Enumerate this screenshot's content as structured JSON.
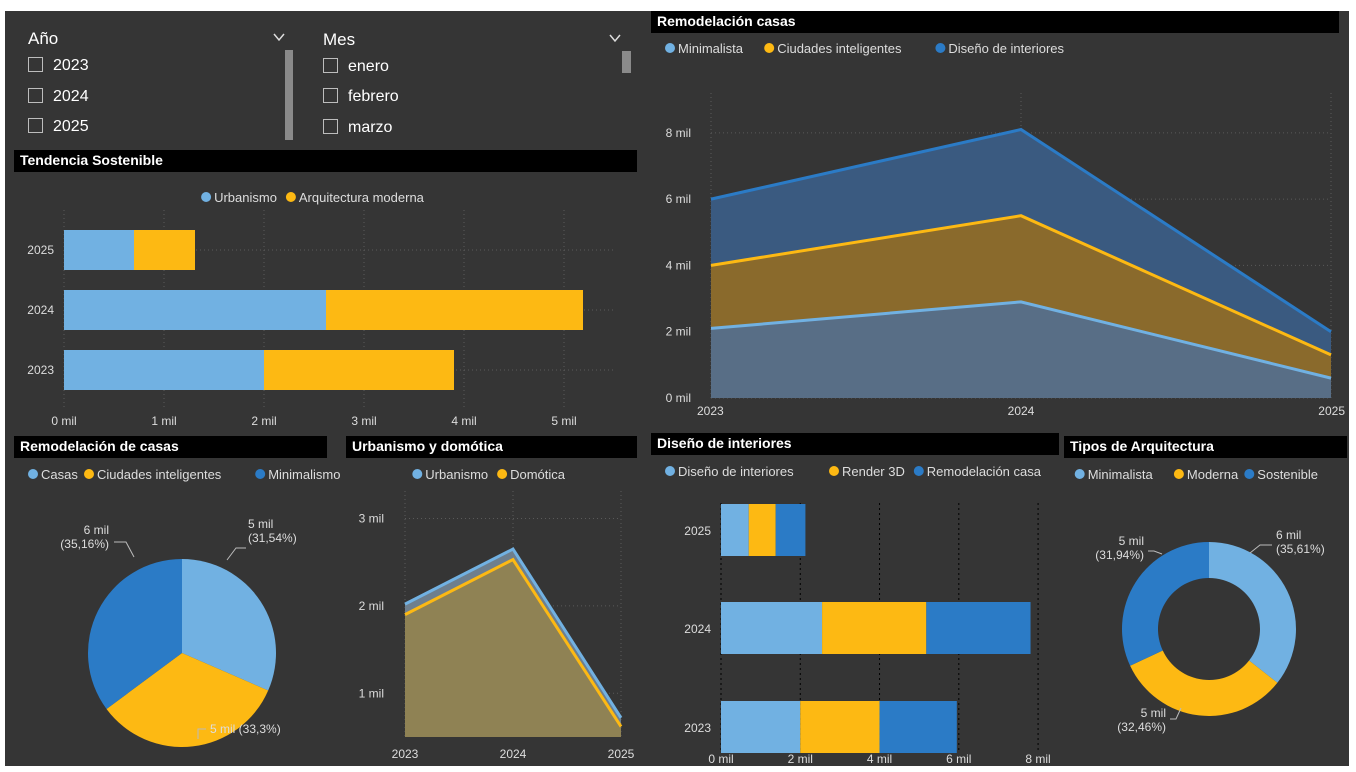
{
  "slicers": {
    "year": {
      "title": "Año",
      "options": [
        "2023",
        "2024",
        "2025"
      ]
    },
    "month": {
      "title": "Mes",
      "options": [
        "enero",
        "febrero",
        "marzo"
      ]
    }
  },
  "chart_data": [
    {
      "id": "tendencia",
      "type": "bar",
      "orientation": "horizontal",
      "stacked": true,
      "title": "Tendencia Sostenible",
      "categories": [
        "2025",
        "2024",
        "2023"
      ],
      "series": [
        {
          "name": "Urbanismo",
          "color": "#71B1E2",
          "values": [
            700,
            2620,
            2000
          ]
        },
        {
          "name": "Arquitectura moderna",
          "color": "#FDB913",
          "values": [
            610,
            2570,
            1900
          ]
        }
      ],
      "xlim": [
        0,
        5500
      ],
      "xticks": [
        0,
        1000,
        2000,
        3000,
        4000,
        5000
      ],
      "xtick_labels": [
        "0 mil",
        "1 mil",
        "2 mil",
        "3 mil",
        "4 mil",
        "5 mil"
      ],
      "legend": "top-center"
    },
    {
      "id": "remodelacion_area",
      "type": "area",
      "title": "Remodelación casas",
      "x": [
        "2023",
        "2024",
        "2025"
      ],
      "series": [
        {
          "name": "Minimalista",
          "color": "#71B1E2",
          "values": [
            2100,
            2900,
            600
          ]
        },
        {
          "name": "Ciudades inteligentes",
          "color": "#FDB913",
          "values": [
            4000,
            5500,
            1300
          ]
        },
        {
          "name": "Diseño de interiores",
          "color": "#2B7BC6",
          "values": [
            6000,
            8100,
            2000
          ]
        }
      ],
      "ylim": [
        0,
        8900
      ],
      "yticks": [
        0,
        2000,
        4000,
        6000,
        8000
      ],
      "ytick_labels": [
        "0 mil",
        "2 mil",
        "4 mil",
        "6 mil",
        "8 mil"
      ],
      "legend": "top-left"
    },
    {
      "id": "remodelacion_pie",
      "type": "pie",
      "title": "Remodelación de casas",
      "labels": [
        "Casas",
        "Ciudades inteligentes",
        "Minimalismo"
      ],
      "colors": [
        "#71B1E2",
        "#FDB913",
        "#2B7BC6"
      ],
      "values": [
        31.54,
        33.3,
        35.16
      ],
      "data_labels": [
        [
          "5 mil",
          "(31,54%)"
        ],
        [
          "5 mil (33,3%)"
        ],
        [
          "6 mil",
          "(35,16%)"
        ]
      ],
      "legend": "top-left"
    },
    {
      "id": "urbanismo_domotica",
      "type": "area",
      "title": "Urbanismo y domótica",
      "x": [
        "2023",
        "2024",
        "2025"
      ],
      "series": [
        {
          "name": "Urbanismo",
          "color": "#71B1E2",
          "values": [
            2020,
            2650,
            720
          ]
        },
        {
          "name": "Domótica",
          "color": "#FDB913",
          "values": [
            1900,
            2530,
            620
          ]
        }
      ],
      "ylim": [
        0.5,
        3.2
      ],
      "ylim_note": "",
      "yticks": [
        1000,
        2000,
        3000
      ],
      "ytick_labels": [
        "1 mil",
        "2 mil",
        "3 mil"
      ],
      "legend": "top-center"
    },
    {
      "id": "diseno_interiores",
      "type": "bar",
      "orientation": "horizontal",
      "stacked": true,
      "title": "Diseño de interiores",
      "categories": [
        "2025",
        "2024",
        "2023"
      ],
      "series": [
        {
          "name": "Diseño de interiores",
          "color": "#71B1E2",
          "values": [
            700,
            2550,
            2000
          ]
        },
        {
          "name": "Render 3D",
          "color": "#FDB913",
          "values": [
            680,
            2630,
            2000
          ]
        },
        {
          "name": "Remodelación casa",
          "color": "#2B7BC6",
          "values": [
            750,
            2630,
            1950
          ]
        }
      ],
      "xlim": [
        0,
        8200
      ],
      "xticks": [
        0,
        2000,
        4000,
        6000,
        8000
      ],
      "xtick_labels": [
        "0 mil",
        "2 mil",
        "4 mil",
        "6 mil",
        "8 mil"
      ],
      "legend": "top-left"
    },
    {
      "id": "tipos_arquitectura",
      "type": "pie",
      "donut": true,
      "title": "Tipos de Arquitectura",
      "labels": [
        "Minimalista",
        "Moderna",
        "Sostenible"
      ],
      "colors": [
        "#71B1E2",
        "#FDB913",
        "#2B7BC6"
      ],
      "values": [
        35.61,
        32.46,
        31.94
      ],
      "data_labels": [
        [
          "6 mil",
          "(35,61%)"
        ],
        [
          "5 mil",
          "(32,46%)"
        ],
        [
          "5 mil",
          "(31,94%)"
        ]
      ],
      "legend": "top-center"
    }
  ]
}
